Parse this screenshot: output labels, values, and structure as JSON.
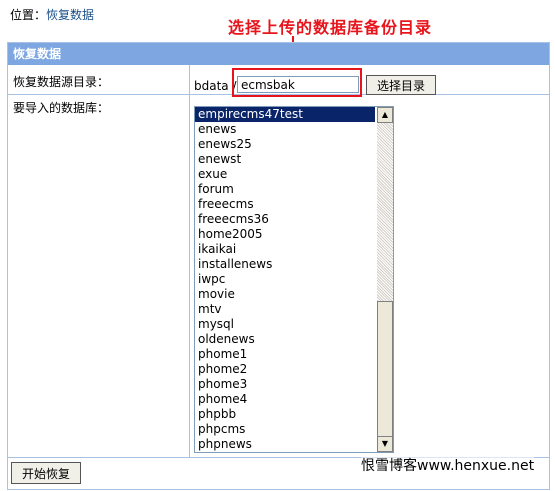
{
  "breadcrumb": {
    "prefix": "位置：",
    "link": "恢复数据"
  },
  "annotation": "选择上传的数据库备份目录",
  "panel": {
    "header": "恢复数据",
    "dir_label": "恢复数据源目录：",
    "dir_prefix": "bdata /",
    "dir_value": "ecmsbak",
    "select_dir_button": "选择目录",
    "db_label": "要导入的数据库：",
    "databases": [
      "empirecms47test",
      "enews",
      "enews25",
      "enewst",
      "exue",
      "forum",
      "freeecms",
      "freeecms36",
      "home2005",
      "ikaikai",
      "installenews",
      "iwpc",
      "movie",
      "mtv",
      "mysql",
      "oldenews",
      "phome1",
      "phome2",
      "phome3",
      "phome4",
      "phpbb",
      "phpcms",
      "phpnews"
    ],
    "selected_database": "empirecms47test",
    "start_button": "开始恢复"
  },
  "watermark": "恨雪博客www.henxue.net",
  "colors": {
    "header_bg": "#7ea6e0",
    "border": "#a8c2e6",
    "annotation": "#e8141c",
    "selection": "#0a246a"
  }
}
